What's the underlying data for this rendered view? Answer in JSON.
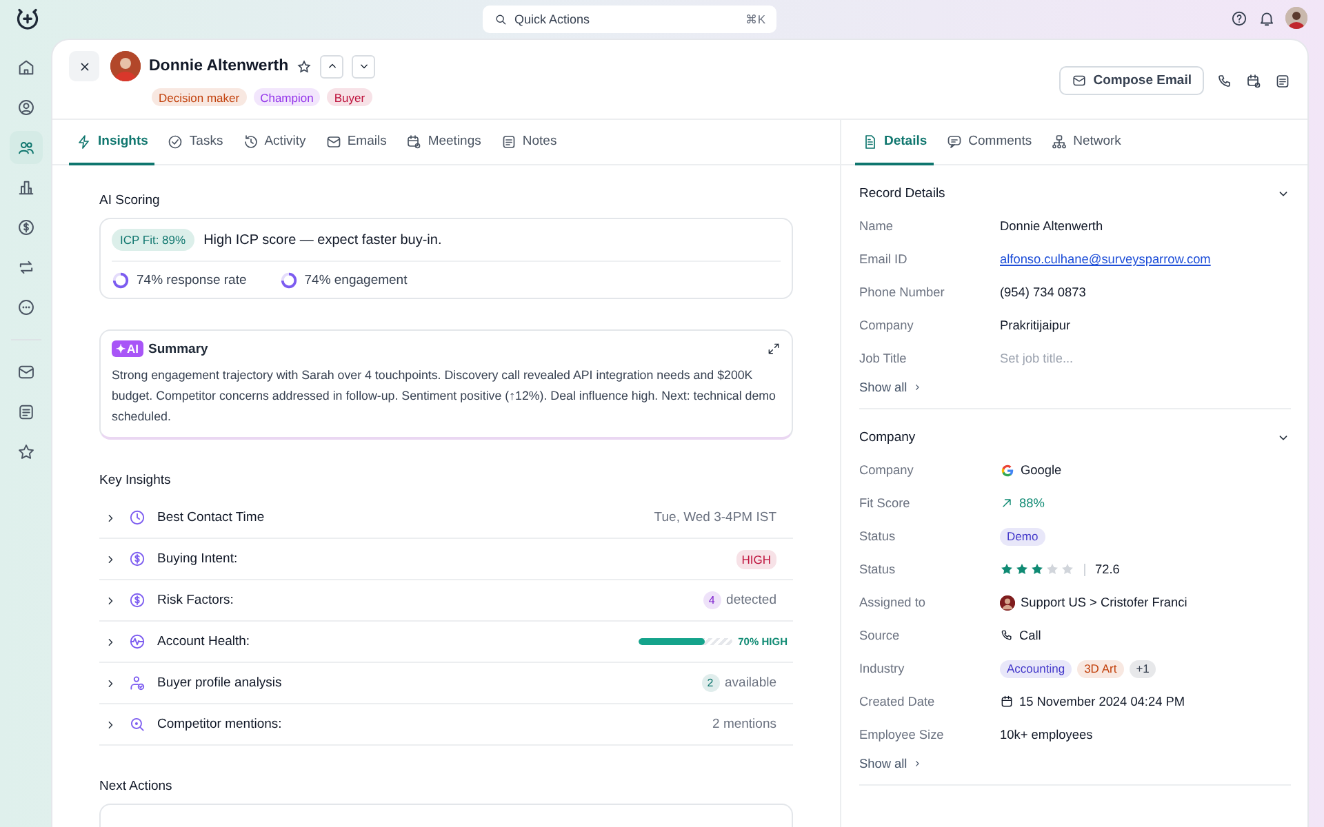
{
  "topbar": {
    "search": {
      "placeholder": "Quick Actions",
      "shortcut": "⌘K"
    }
  },
  "sidebar": {
    "main_items": [
      {
        "selected": false
      },
      {
        "selected": false
      },
      {
        "selected": true
      },
      {
        "selected": false
      },
      {
        "selected": false
      },
      {
        "selected": false
      },
      {
        "selected": false
      }
    ],
    "bottom_items": [
      {
        "selected": false
      },
      {
        "selected": false
      },
      {
        "selected": false
      }
    ]
  },
  "record": {
    "name": "Donnie Altenwerth",
    "starred": false,
    "tags": [
      {
        "label": "Decision maker",
        "color": "#c2410c"
      },
      {
        "label": "Champion",
        "color": "#9333ea"
      },
      {
        "label": "Buyer",
        "color": "#be123c"
      }
    ],
    "actions": {
      "compose": "Compose Email"
    }
  },
  "left_tabs": [
    {
      "label": "Insights",
      "selected": true
    },
    {
      "label": "Tasks",
      "selected": false
    },
    {
      "label": "Activity",
      "selected": false
    },
    {
      "label": "Emails",
      "selected": false
    },
    {
      "label": "Meetings",
      "selected": false
    },
    {
      "label": "Notes",
      "selected": false
    }
  ],
  "ai_scoring": {
    "title": "AI Scoring",
    "fit_badge": "ICP Fit: 89%",
    "headline": "High ICP score — expect faster buy-in.",
    "metrics": [
      {
        "label": "74% response rate"
      },
      {
        "label": "74% engagement"
      }
    ]
  },
  "summary": {
    "badge": "✦AI",
    "title": "Summary",
    "text": "Strong engagement trajectory with Sarah over 4 touchpoints. Discovery call revealed API integration needs and $200K budget. Competitor concerns addressed in follow-up. Sentiment positive (↑12%). Deal influence high. Next: technical demo scheduled."
  },
  "key_insights": {
    "title": "Key Insights",
    "rows": [
      {
        "label": "Best Contact Time",
        "expanded": false,
        "kind": "text",
        "value": "Tue, Wed 3-4PM IST"
      },
      {
        "label": "Buying Intent:",
        "expanded": false,
        "kind": "badge",
        "value": "HIGH",
        "color": "#be123c"
      },
      {
        "label": "Risk Factors:",
        "expanded": false,
        "kind": "count",
        "count": "4",
        "value": "detected",
        "color": "#7e22ce"
      },
      {
        "label": "Account Health:",
        "expanded": false,
        "kind": "meter",
        "level": 0.7,
        "value": "70% HIGH"
      },
      {
        "label": "Buyer profile analysis",
        "expanded": false,
        "kind": "count",
        "count": "2",
        "value": "available",
        "color": "#0f766e"
      },
      {
        "label": "Competitor mentions:",
        "expanded": false,
        "kind": "text",
        "value": "2 mentions"
      }
    ]
  },
  "next_actions": {
    "title": "Next Actions"
  },
  "right_tabs": [
    {
      "label": "Details",
      "selected": true
    },
    {
      "label": "Comments",
      "selected": false
    },
    {
      "label": "Network",
      "selected": false
    }
  ],
  "sections": [
    {
      "title": "Record Details",
      "expanded": true,
      "show_all": "Show all",
      "fields": [
        {
          "label": "Name",
          "kind": "text",
          "value": "Donnie Altenwerth"
        },
        {
          "label": "Email ID",
          "kind": "link",
          "value": "alfonso.culhane@surveysparrow.com"
        },
        {
          "label": "Phone Number",
          "kind": "text",
          "value": "(954) 734 0873"
        },
        {
          "label": "Company",
          "kind": "text",
          "value": "Prakritijaipur"
        },
        {
          "label": "Job Title",
          "kind": "field",
          "placeholder": "Set job title..."
        }
      ]
    },
    {
      "title": "Company",
      "expanded": true,
      "show_all": "Show all",
      "fields": [
        {
          "label": "Company",
          "kind": "company",
          "value": "Google"
        },
        {
          "label": "Fit Score",
          "kind": "trend",
          "value": "88%"
        },
        {
          "label": "Status",
          "kind": "tags",
          "tags": [
            {
              "label": "Demo",
              "color": "#4338ca"
            }
          ]
        },
        {
          "label": "Status",
          "kind": "rating",
          "stars": 3,
          "value": "72.6"
        },
        {
          "label": "Assigned to",
          "kind": "person",
          "value": "Support US > Cristofer Franci"
        },
        {
          "label": "Source",
          "kind": "phone",
          "value": "Call"
        },
        {
          "label": "Industry",
          "kind": "tags",
          "tags": [
            {
              "label": "Accounting",
              "color": "#4338ca"
            },
            {
              "label": "3D Art",
              "color": "#c2410c"
            },
            {
              "label": "+1",
              "color": "#374151"
            }
          ]
        },
        {
          "label": "Created Date",
          "kind": "date",
          "value": "15 November 2024 04:24 PM"
        },
        {
          "label": "Employee Size",
          "kind": "text",
          "value": "10k+ employees"
        }
      ]
    }
  ]
}
